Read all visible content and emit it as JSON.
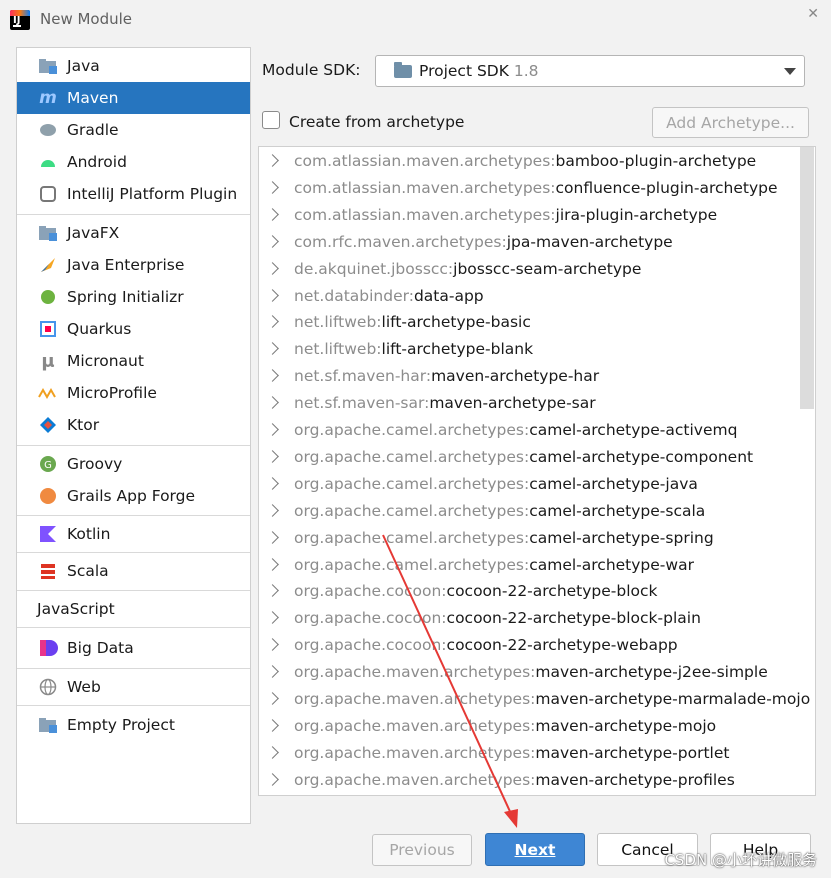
{
  "window": {
    "title": "New Module"
  },
  "sidebar": {
    "items": [
      {
        "label": "Java",
        "icon": "folder-icon",
        "selected": false
      },
      {
        "label": "Maven",
        "icon": "maven-icon",
        "selected": true
      },
      {
        "label": "Gradle",
        "icon": "gradle-elephant-icon",
        "selected": false
      },
      {
        "label": "Android",
        "icon": "android-icon",
        "selected": false
      },
      {
        "label": "IntelliJ Platform Plugin",
        "icon": "plugin-icon",
        "selected": false
      },
      {
        "label": "JavaFX",
        "icon": "folder-icon",
        "selected": false
      },
      {
        "label": "Java Enterprise",
        "icon": "java-enterprise-icon",
        "selected": false
      },
      {
        "label": "Spring Initializr",
        "icon": "spring-icon",
        "selected": false
      },
      {
        "label": "Quarkus",
        "icon": "quarkus-icon",
        "selected": false
      },
      {
        "label": "Micronaut",
        "icon": "micronaut-icon",
        "selected": false
      },
      {
        "label": "MicroProfile",
        "icon": "microprofile-icon",
        "selected": false
      },
      {
        "label": "Ktor",
        "icon": "ktor-icon",
        "selected": false
      },
      {
        "label": "Groovy",
        "icon": "groovy-icon",
        "selected": false
      },
      {
        "label": "Grails App Forge",
        "icon": "grails-icon",
        "selected": false
      },
      {
        "label": "Kotlin",
        "icon": "kotlin-icon",
        "selected": false
      },
      {
        "label": "Scala",
        "icon": "scala-icon",
        "selected": false
      },
      {
        "label": "JavaScript",
        "icon": "",
        "selected": false
      },
      {
        "label": "Big Data",
        "icon": "big-data-icon",
        "selected": false
      },
      {
        "label": "Web",
        "icon": "globe-icon",
        "selected": false
      },
      {
        "label": "Empty Project",
        "icon": "folder-icon",
        "selected": false
      }
    ]
  },
  "sdk": {
    "label": "Module SDK:",
    "value": "Project SDK",
    "version": "1.8"
  },
  "archetype": {
    "checkbox_label": "Create from archetype",
    "checked": false,
    "add_button": "Add Archetype..."
  },
  "archetypes": [
    {
      "group": "com.atlassian.maven.archetypes:",
      "artifact": "bamboo-plugin-archetype"
    },
    {
      "group": "com.atlassian.maven.archetypes:",
      "artifact": "confluence-plugin-archetype"
    },
    {
      "group": "com.atlassian.maven.archetypes:",
      "artifact": "jira-plugin-archetype"
    },
    {
      "group": "com.rfc.maven.archetypes:",
      "artifact": "jpa-maven-archetype"
    },
    {
      "group": "de.akquinet.jbosscc:",
      "artifact": "jbosscc-seam-archetype"
    },
    {
      "group": "net.databinder:",
      "artifact": "data-app"
    },
    {
      "group": "net.liftweb:",
      "artifact": "lift-archetype-basic"
    },
    {
      "group": "net.liftweb:",
      "artifact": "lift-archetype-blank"
    },
    {
      "group": "net.sf.maven-har:",
      "artifact": "maven-archetype-har"
    },
    {
      "group": "net.sf.maven-sar:",
      "artifact": "maven-archetype-sar"
    },
    {
      "group": "org.apache.camel.archetypes:",
      "artifact": "camel-archetype-activemq"
    },
    {
      "group": "org.apache.camel.archetypes:",
      "artifact": "camel-archetype-component"
    },
    {
      "group": "org.apache.camel.archetypes:",
      "artifact": "camel-archetype-java"
    },
    {
      "group": "org.apache.camel.archetypes:",
      "artifact": "camel-archetype-scala"
    },
    {
      "group": "org.apache.camel.archetypes:",
      "artifact": "camel-archetype-spring"
    },
    {
      "group": "org.apache.camel.archetypes:",
      "artifact": "camel-archetype-war"
    },
    {
      "group": "org.apache.cocoon:",
      "artifact": "cocoon-22-archetype-block"
    },
    {
      "group": "org.apache.cocoon:",
      "artifact": "cocoon-22-archetype-block-plain"
    },
    {
      "group": "org.apache.cocoon:",
      "artifact": "cocoon-22-archetype-webapp"
    },
    {
      "group": "org.apache.maven.archetypes:",
      "artifact": "maven-archetype-j2ee-simple"
    },
    {
      "group": "org.apache.maven.archetypes:",
      "artifact": "maven-archetype-marmalade-mojo"
    },
    {
      "group": "org.apache.maven.archetypes:",
      "artifact": "maven-archetype-mojo"
    },
    {
      "group": "org.apache.maven.archetypes:",
      "artifact": "maven-archetype-portlet"
    },
    {
      "group": "org.apache.maven.archetypes:",
      "artifact": "maven-archetype-profiles"
    }
  ],
  "footer": {
    "previous": "Previous",
    "next": "Next",
    "cancel": "Cancel",
    "help": "Help"
  },
  "watermark": "CSDN @小坏讲微服务",
  "colors": {
    "selection": "#2675bf",
    "primary_button": "#3e86d4",
    "annotation_arrow": "#e53935"
  }
}
